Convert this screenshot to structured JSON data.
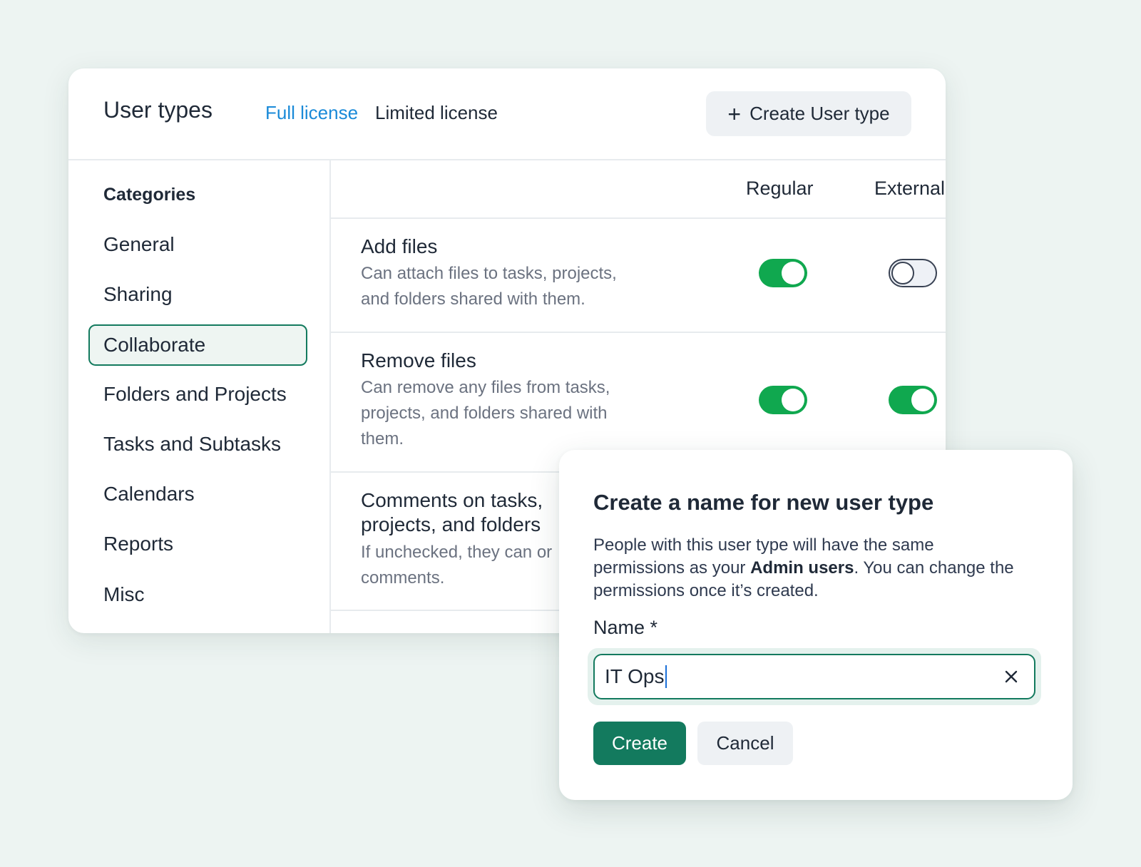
{
  "header": {
    "title": "User types",
    "tabs": [
      {
        "label": "Full license",
        "active": true
      },
      {
        "label": "Limited license",
        "active": false
      }
    ],
    "create_button": "Create User type",
    "create_icon": "+"
  },
  "sidebar": {
    "heading": "Categories",
    "items": [
      {
        "label": "General"
      },
      {
        "label": "Sharing"
      },
      {
        "label": "Collaborate",
        "active": true
      },
      {
        "label": "Folders and Projects"
      },
      {
        "label": "Tasks and Subtasks"
      },
      {
        "label": "Calendars"
      },
      {
        "label": "Reports"
      },
      {
        "label": "Misc"
      }
    ]
  },
  "table": {
    "columns": [
      "Regular",
      "External"
    ],
    "rows": [
      {
        "title": "Add files",
        "description": "Can attach files to tasks, projects, and folders shared with them.",
        "regular": true,
        "external": false
      },
      {
        "title": "Remove files",
        "description": "Can remove any files from tasks, projects, and folders shared with them.",
        "regular": true,
        "external": true
      },
      {
        "title": "Comments on tasks, projects, and folders",
        "description": "If unchecked, they can or comments."
      }
    ]
  },
  "dialog": {
    "title": "Create a name for new user type",
    "body_before": "People with this user type will have the same permissions as your ",
    "body_bold": "Admin users",
    "body_after": ". You can change the permissions once it’s created.",
    "field_label": "Name *",
    "input_value": "IT Ops",
    "create_label": "Create",
    "cancel_label": "Cancel"
  },
  "colors": {
    "accent_green": "#137a5e",
    "toggle_on": "#10a84f",
    "link_blue": "#1a8ad8",
    "background": "#edf4f2"
  }
}
